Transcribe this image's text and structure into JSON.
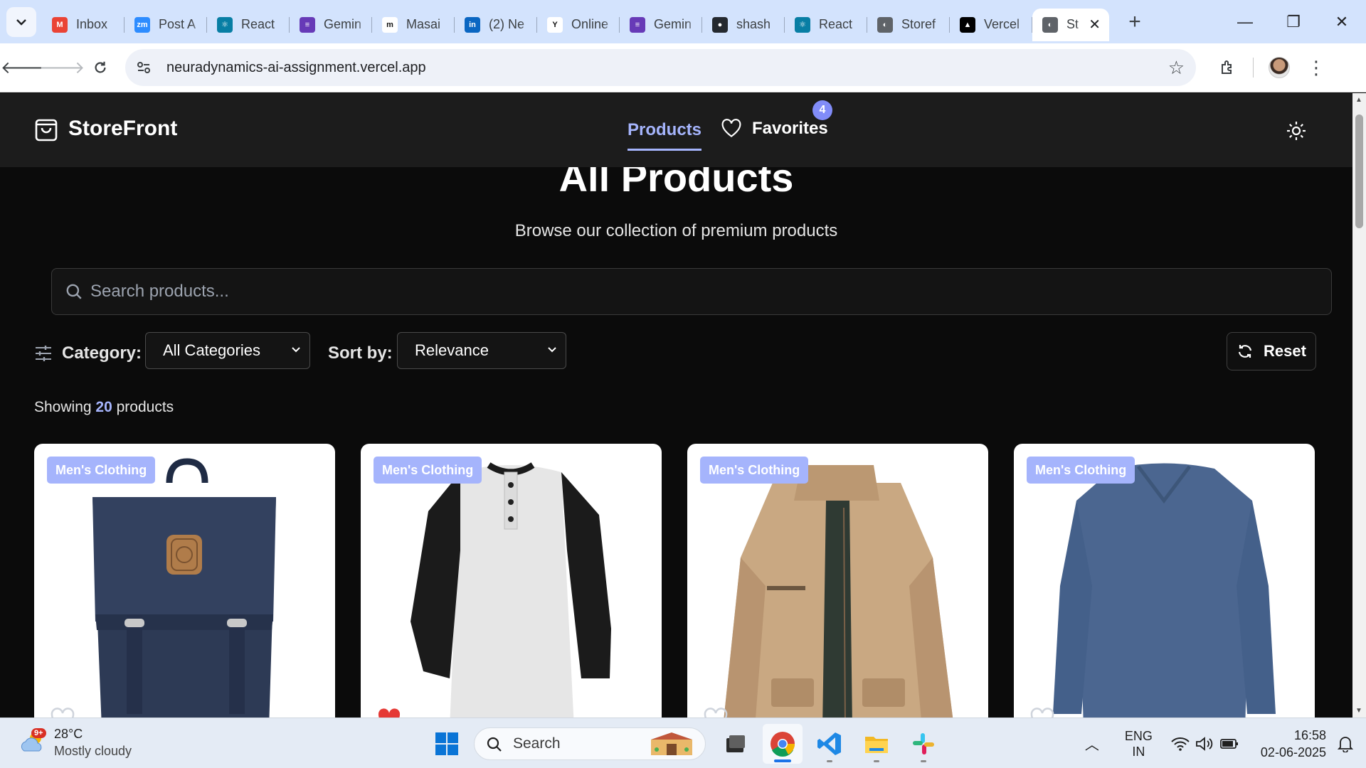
{
  "browser": {
    "tabs": [
      {
        "title": "Inbox",
        "favicon": "gmail-icon",
        "color": "#ea4335"
      },
      {
        "title": "Post A",
        "favicon": "zoom-icon",
        "color": "#2d8cff"
      },
      {
        "title": "React",
        "favicon": "react-icon",
        "color": "#087ea4"
      },
      {
        "title": "Gemin",
        "favicon": "forms-icon",
        "color": "#673ab7"
      },
      {
        "title": "Masai",
        "favicon": "masai-icon",
        "color": "#ffffff"
      },
      {
        "title": "(2) Ne",
        "favicon": "linkedin-icon",
        "color": "#0a66c2"
      },
      {
        "title": "Online",
        "favicon": "yc-icon",
        "color": "#ffffff"
      },
      {
        "title": "Gemin",
        "favicon": "forms-icon",
        "color": "#673ab7"
      },
      {
        "title": "shash",
        "favicon": "github-icon",
        "color": "#24292f"
      },
      {
        "title": "React",
        "favicon": "react-icon",
        "color": "#087ea4"
      },
      {
        "title": "Storef",
        "favicon": "globe-icon",
        "color": "#5f6368"
      },
      {
        "title": "Vercel",
        "favicon": "vercel-icon",
        "color": "#000000"
      }
    ],
    "active_tab": {
      "title": "St",
      "favicon": "globe-icon"
    },
    "url": "neuradynamics-ai-assignment.vercel.app"
  },
  "app": {
    "brand": "StoreFront",
    "nav": {
      "products": "Products",
      "favorites": "Favorites",
      "favorites_count": "4"
    },
    "accent": "#a5b4fc",
    "title": "All Products",
    "subtitle": "Browse our collection of premium products",
    "search": {
      "placeholder": "Search products..."
    },
    "filters": {
      "category_label": "Category:",
      "category_value": "All Categories",
      "sort_label": "Sort by:",
      "sort_value": "Relevance",
      "reset": "Reset"
    },
    "count": {
      "prefix": "Showing",
      "number": "20",
      "suffix": "products"
    },
    "products": [
      {
        "category": "Men's Clothing",
        "image": "backpack",
        "favorited": false
      },
      {
        "category": "Men's Clothing",
        "image": "raglan-tshirt",
        "favorited": true
      },
      {
        "category": "Men's Clothing",
        "image": "cotton-jacket",
        "favorited": false
      },
      {
        "category": "Men's Clothing",
        "image": "slim-tshirt",
        "favorited": false
      }
    ]
  },
  "taskbar": {
    "weather": {
      "temp": "28°C",
      "desc": "Mostly cloudy",
      "badge": "9+"
    },
    "search": "Search",
    "lang": {
      "line1": "ENG",
      "line2": "IN"
    },
    "time": "16:58",
    "date": "02-06-2025"
  }
}
